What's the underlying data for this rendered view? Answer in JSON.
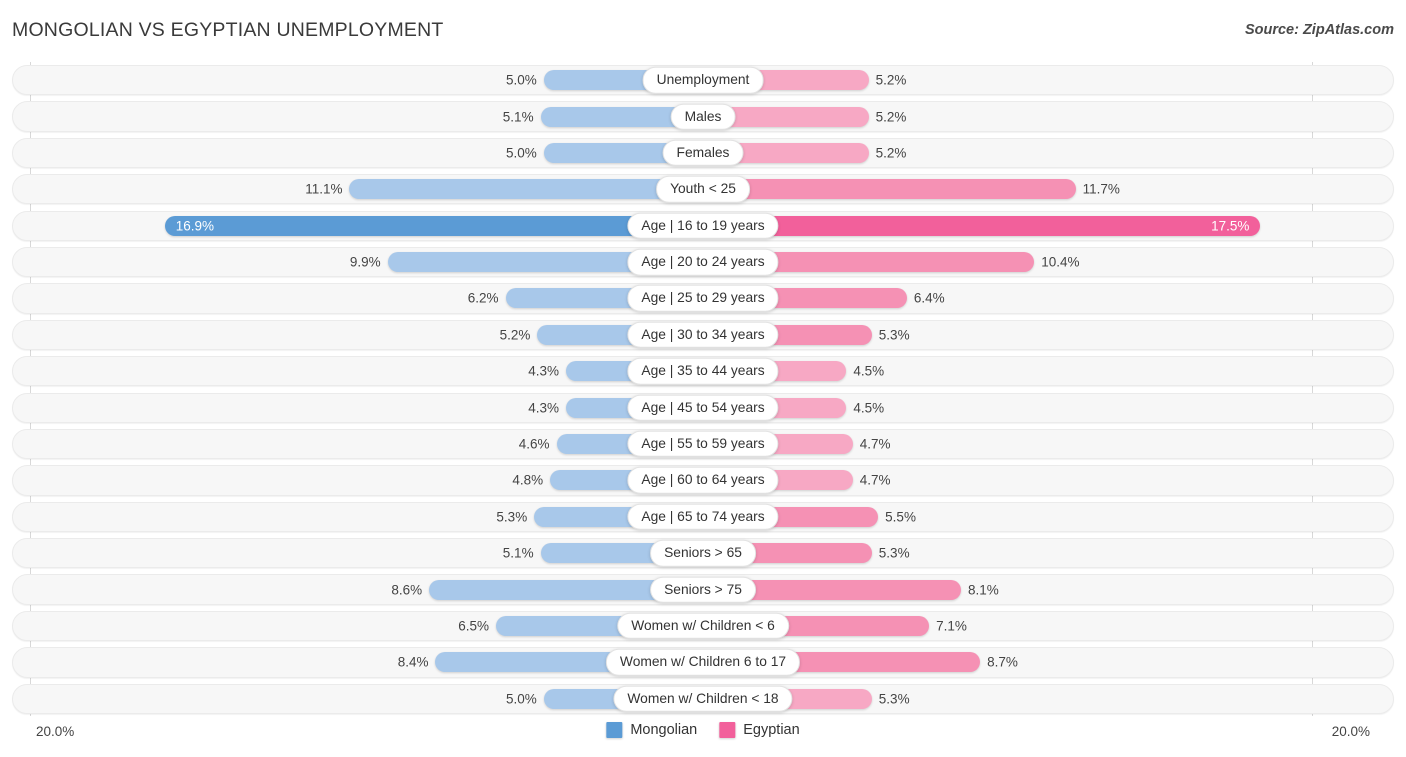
{
  "header": {
    "title": "MONGOLIAN VS EGYPTIAN UNEMPLOYMENT",
    "source": "Source: ZipAtlas.com"
  },
  "axis": {
    "min_label": "20.0%",
    "max_label": "20.0%"
  },
  "legend": {
    "items": [
      {
        "label": "Mongolian",
        "color": "#5b9bd5"
      },
      {
        "label": "Egyptian",
        "color": "#f2609b"
      }
    ]
  },
  "colors": {
    "left_light": "#a8c8ea",
    "left_dark": "#5b9bd5",
    "right_light": "#f7a8c4",
    "right_mid": "#f591b4",
    "right_dark": "#f2609b",
    "track": "#f7f7f7",
    "track_border": "#ebebeb"
  },
  "chart_data": {
    "type": "bar",
    "orientation": "horizontal-diverging",
    "title": "MONGOLIAN VS EGYPTIAN UNEMPLOYMENT",
    "xlabel": "",
    "ylabel": "",
    "xlim": [
      20.0,
      20.0
    ],
    "unit": "%",
    "grid": false,
    "legend_position": "bottom-center",
    "categories": [
      "Unemployment",
      "Males",
      "Females",
      "Youth < 25",
      "Age | 16 to 19 years",
      "Age | 20 to 24 years",
      "Age | 25 to 29 years",
      "Age | 30 to 34 years",
      "Age | 35 to 44 years",
      "Age | 45 to 54 years",
      "Age | 55 to 59 years",
      "Age | 60 to 64 years",
      "Age | 65 to 74 years",
      "Seniors > 65",
      "Seniors > 75",
      "Women w/ Children < 6",
      "Women w/ Children 6 to 17",
      "Women w/ Children < 18"
    ],
    "series": [
      {
        "name": "Mongolian",
        "color": "#5b9bd5",
        "values": [
          5.0,
          5.1,
          5.0,
          11.1,
          16.9,
          9.9,
          6.2,
          5.2,
          4.3,
          4.3,
          4.6,
          4.8,
          5.3,
          5.1,
          8.6,
          6.5,
          8.4,
          5.0
        ]
      },
      {
        "name": "Egyptian",
        "color": "#f2609b",
        "values": [
          5.2,
          5.2,
          5.2,
          11.7,
          17.5,
          10.4,
          6.4,
          5.3,
          4.5,
          4.5,
          4.7,
          4.7,
          5.5,
          5.3,
          8.1,
          7.1,
          8.7,
          5.3
        ]
      }
    ]
  },
  "rows": [
    {
      "label": "Unemployment",
      "left_value": "5.0%",
      "right_value": "5.2%",
      "left_num": 5.0,
      "right_num": 5.2,
      "left_shade": "light",
      "right_shade": "light",
      "left_inside": false,
      "right_inside": false
    },
    {
      "label": "Males",
      "left_value": "5.1%",
      "right_value": "5.2%",
      "left_num": 5.1,
      "right_num": 5.2,
      "left_shade": "light",
      "right_shade": "light",
      "left_inside": false,
      "right_inside": false
    },
    {
      "label": "Females",
      "left_value": "5.0%",
      "right_value": "5.2%",
      "left_num": 5.0,
      "right_num": 5.2,
      "left_shade": "light",
      "right_shade": "light",
      "left_inside": false,
      "right_inside": false
    },
    {
      "label": "Youth < 25",
      "left_value": "11.1%",
      "right_value": "11.7%",
      "left_num": 11.1,
      "right_num": 11.7,
      "left_shade": "mid",
      "right_shade": "mid",
      "left_inside": false,
      "right_inside": false
    },
    {
      "label": "Age | 16 to 19 years",
      "left_value": "16.9%",
      "right_value": "17.5%",
      "left_num": 16.9,
      "right_num": 17.5,
      "left_shade": "dark",
      "right_shade": "dark",
      "left_inside": true,
      "right_inside": true
    },
    {
      "label": "Age | 20 to 24 years",
      "left_value": "9.9%",
      "right_value": "10.4%",
      "left_num": 9.9,
      "right_num": 10.4,
      "left_shade": "mid",
      "right_shade": "mid",
      "left_inside": false,
      "right_inside": false
    },
    {
      "label": "Age | 25 to 29 years",
      "left_value": "6.2%",
      "right_value": "6.4%",
      "left_num": 6.2,
      "right_num": 6.4,
      "left_shade": "light",
      "right_shade": "mid",
      "left_inside": false,
      "right_inside": false
    },
    {
      "label": "Age | 30 to 34 years",
      "left_value": "5.2%",
      "right_value": "5.3%",
      "left_num": 5.2,
      "right_num": 5.3,
      "left_shade": "light",
      "right_shade": "mid",
      "left_inside": false,
      "right_inside": false
    },
    {
      "label": "Age | 35 to 44 years",
      "left_value": "4.3%",
      "right_value": "4.5%",
      "left_num": 4.3,
      "right_num": 4.5,
      "left_shade": "light",
      "right_shade": "light",
      "left_inside": false,
      "right_inside": false
    },
    {
      "label": "Age | 45 to 54 years",
      "left_value": "4.3%",
      "right_value": "4.5%",
      "left_num": 4.3,
      "right_num": 4.5,
      "left_shade": "light",
      "right_shade": "light",
      "left_inside": false,
      "right_inside": false
    },
    {
      "label": "Age | 55 to 59 years",
      "left_value": "4.6%",
      "right_value": "4.7%",
      "left_num": 4.6,
      "right_num": 4.7,
      "left_shade": "light",
      "right_shade": "light",
      "left_inside": false,
      "right_inside": false
    },
    {
      "label": "Age | 60 to 64 years",
      "left_value": "4.8%",
      "right_value": "4.7%",
      "left_num": 4.8,
      "right_num": 4.7,
      "left_shade": "light",
      "right_shade": "light",
      "left_inside": false,
      "right_inside": false
    },
    {
      "label": "Age | 65 to 74 years",
      "left_value": "5.3%",
      "right_value": "5.5%",
      "left_num": 5.3,
      "right_num": 5.5,
      "left_shade": "light",
      "right_shade": "mid",
      "left_inside": false,
      "right_inside": false
    },
    {
      "label": "Seniors > 65",
      "left_value": "5.1%",
      "right_value": "5.3%",
      "left_num": 5.1,
      "right_num": 5.3,
      "left_shade": "light",
      "right_shade": "mid",
      "left_inside": false,
      "right_inside": false
    },
    {
      "label": "Seniors > 75",
      "left_value": "8.6%",
      "right_value": "8.1%",
      "left_num": 8.6,
      "right_num": 8.1,
      "left_shade": "mid",
      "right_shade": "mid",
      "left_inside": false,
      "right_inside": false
    },
    {
      "label": "Women w/ Children < 6",
      "left_value": "6.5%",
      "right_value": "7.1%",
      "left_num": 6.5,
      "right_num": 7.1,
      "left_shade": "light",
      "right_shade": "mid",
      "left_inside": false,
      "right_inside": false
    },
    {
      "label": "Women w/ Children 6 to 17",
      "left_value": "8.4%",
      "right_value": "8.7%",
      "left_num": 8.4,
      "right_num": 8.7,
      "left_shade": "mid",
      "right_shade": "mid",
      "left_inside": false,
      "right_inside": false
    },
    {
      "label": "Women w/ Children < 18",
      "left_value": "5.0%",
      "right_value": "5.3%",
      "left_num": 5.0,
      "right_num": 5.3,
      "left_shade": "light",
      "right_shade": "light",
      "left_inside": false,
      "right_inside": false
    }
  ]
}
